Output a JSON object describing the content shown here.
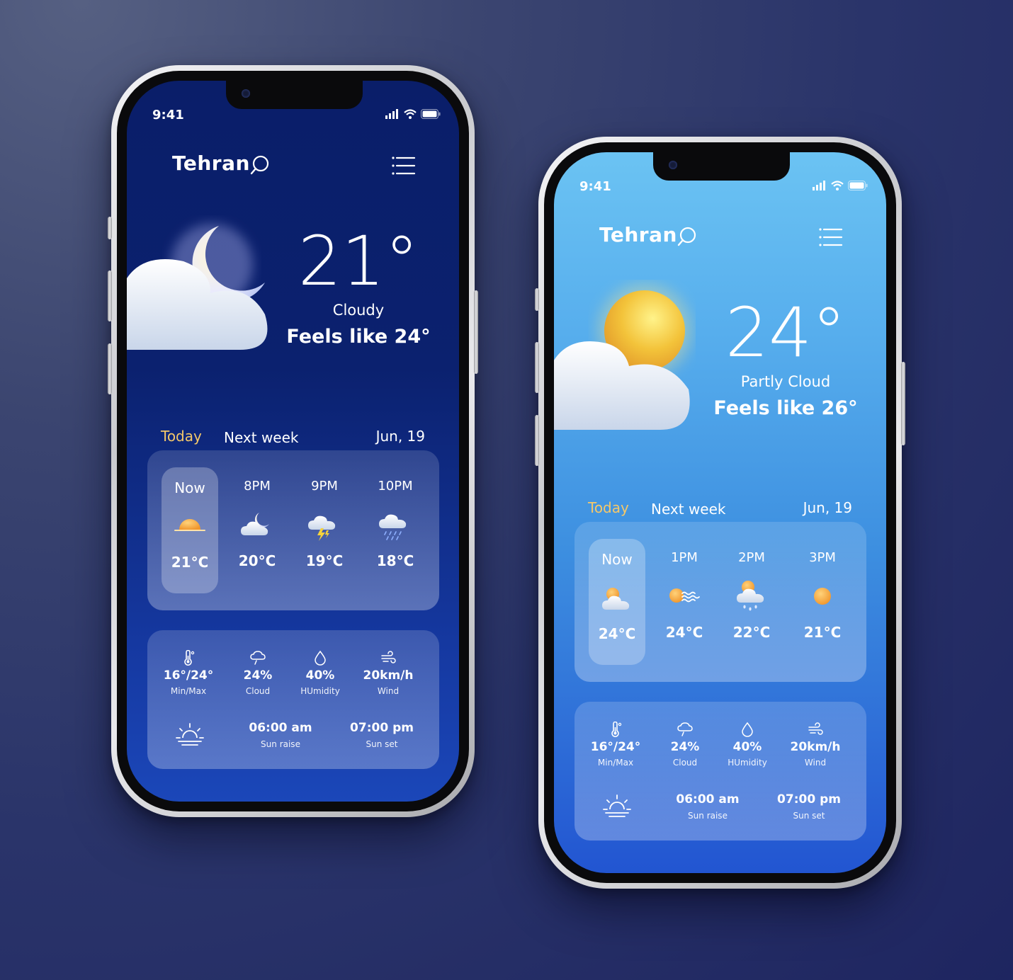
{
  "phones": [
    {
      "status_time": "9:41",
      "city": "Tehran",
      "temperature": "21°",
      "condition": "Cloudy",
      "feels_like": "Feels like 24°",
      "tabs": {
        "today": "Today",
        "next_week": "Next week",
        "date": "Jun, 19"
      },
      "hourly": [
        {
          "label": "Now",
          "icon": "sunset-icon",
          "temp": "21°C"
        },
        {
          "label": "8PM",
          "icon": "cloud-moon-icon",
          "temp": "20°C"
        },
        {
          "label": "9PM",
          "icon": "thunderstorm-icon",
          "temp": "19°C"
        },
        {
          "label": "10PM",
          "icon": "rain-cloud-icon",
          "temp": "18°C"
        }
      ],
      "stats": [
        {
          "icon": "thermometer-icon",
          "value": "16°/24°",
          "label": "Min/Max"
        },
        {
          "icon": "cloud-outline-icon",
          "value": "24%",
          "label": "Cloud"
        },
        {
          "icon": "droplet-icon",
          "value": "40%",
          "label": "HUmidity"
        },
        {
          "icon": "wind-icon",
          "value": "20km/h",
          "label": "Wind"
        }
      ],
      "sun": {
        "rise_time": "06:00 am",
        "rise_label": "Sun raise",
        "set_time": "07:00 pm",
        "set_label": "Sun set"
      },
      "hero_icon": "moon-cloud-icon"
    },
    {
      "status_time": "9:41",
      "city": "Tehran",
      "temperature": "24°",
      "condition": "Partly Cloud",
      "feels_like": "Feels like 26°",
      "tabs": {
        "today": "Today",
        "next_week": "Next week",
        "date": "Jun, 19"
      },
      "hourly": [
        {
          "label": "Now",
          "icon": "sun-cloud-icon",
          "temp": "24°C"
        },
        {
          "label": "1PM",
          "icon": "sun-haze-icon",
          "temp": "24°C"
        },
        {
          "label": "2PM",
          "icon": "sun-rain-icon",
          "temp": "22°C"
        },
        {
          "label": "3PM",
          "icon": "sun-icon",
          "temp": "21°C"
        }
      ],
      "stats": [
        {
          "icon": "thermometer-icon",
          "value": "16°/24°",
          "label": "Min/Max"
        },
        {
          "icon": "cloud-outline-icon",
          "value": "24%",
          "label": "Cloud"
        },
        {
          "icon": "droplet-icon",
          "value": "40%",
          "label": "HUmidity"
        },
        {
          "icon": "wind-icon",
          "value": "20km/h",
          "label": "Wind"
        }
      ],
      "sun": {
        "rise_time": "06:00 am",
        "rise_label": "Sun raise",
        "set_time": "07:00 pm",
        "set_label": "Sun set"
      },
      "hero_icon": "sun-cloud-icon"
    }
  ],
  "colors": {
    "tab_active": "#f4c86a",
    "night_bg": "#0b216f",
    "day_bg": "#57aeed"
  }
}
